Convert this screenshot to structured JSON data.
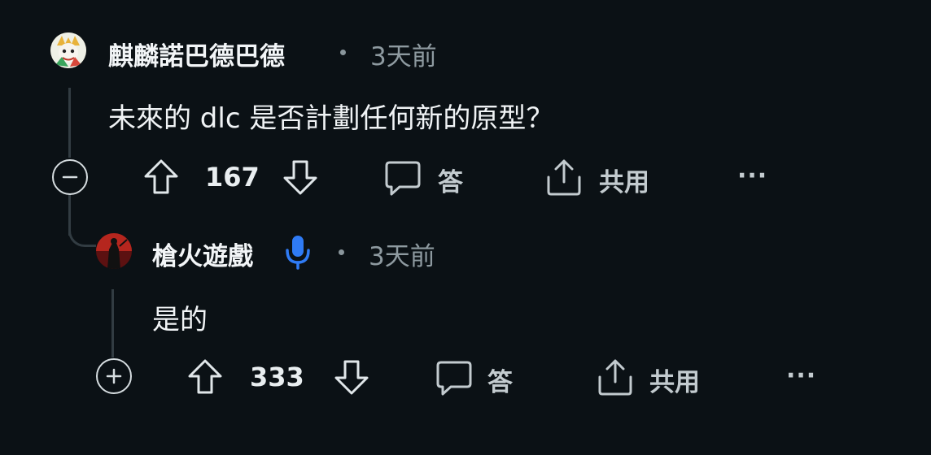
{
  "comments": [
    {
      "username": "麒麟諾巴德巴德",
      "time": "3天前",
      "body": "未來的 dlc 是否計劃任何新的原型？",
      "votes": "167",
      "reply_label": "答",
      "share_label": "共用",
      "more_label": "···"
    },
    {
      "username": "槍火遊戲",
      "time": "3天前",
      "body": "是的",
      "votes": "333",
      "reply_label": "答",
      "share_label": "共用",
      "more_label": "···"
    }
  ],
  "colors": {
    "background": "#0b1115",
    "thread_line": "#323c42",
    "mic_blue": "#2f7bf5"
  },
  "icons": {
    "collapse": "minus-circle-icon",
    "expand": "plus-circle-icon",
    "upvote": "arrow-up-icon",
    "downvote": "arrow-down-icon",
    "reply": "speech-bubble-icon",
    "share": "share-icon",
    "mic": "microphone-icon"
  }
}
